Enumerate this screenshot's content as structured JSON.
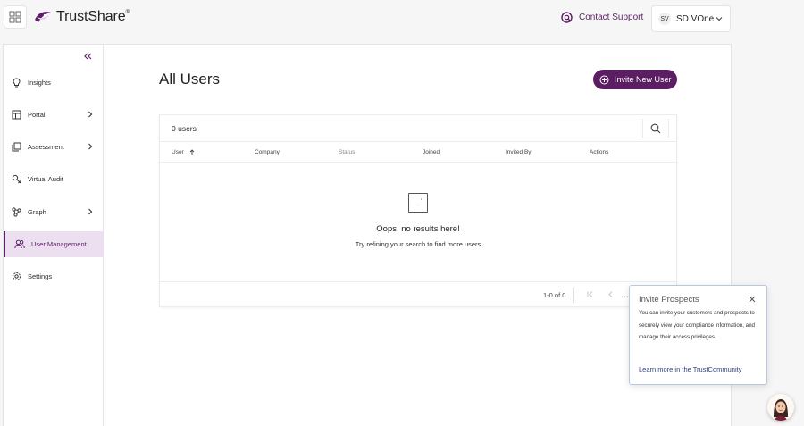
{
  "header": {
    "logo_text": "TrustShare",
    "logo_mark": "®",
    "support_label": "Contact Support",
    "user_initials": "SV",
    "user_name": "SD VOne"
  },
  "sidebar": {
    "items": [
      {
        "label": "Insights",
        "icon": "bulb-icon"
      },
      {
        "label": "Portal",
        "icon": "portal-icon"
      },
      {
        "label": "Assessment",
        "icon": "assessment-icon"
      },
      {
        "label": "Virtual Audit",
        "icon": "audit-icon"
      },
      {
        "label": "Graph",
        "icon": "graph-icon"
      },
      {
        "label": "User Management",
        "icon": "users-icon"
      },
      {
        "label": "Settings",
        "icon": "gear-icon"
      }
    ]
  },
  "main": {
    "title": "All Users",
    "invite_button": "Invite New User",
    "user_count": "0 users",
    "columns": [
      "User",
      "Company",
      "Status",
      "Joined",
      "Invited By",
      "Actions"
    ],
    "empty_title": "Oops, no results here!",
    "empty_subtitle": "Try refining your search to find more users",
    "pager_range": "1-0 of 0"
  },
  "popover": {
    "title": "Invite Prospects",
    "text_1": "You can invite your customers and prospects to securely view your compliance information, and manage their access privileges.",
    "link": "Learn more in the TrustCommunity"
  },
  "colors": {
    "accent": "#5b1e63",
    "active_bg": "#ece0f0",
    "link": "#2d3f7a"
  }
}
